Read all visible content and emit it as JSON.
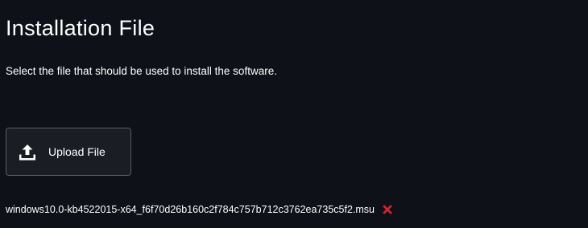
{
  "page": {
    "title": "Installation File",
    "description": "Select the file that should be used to install the software."
  },
  "upload": {
    "label": "Upload File",
    "icon": "upload-icon"
  },
  "file": {
    "name": "windows10.0-kb4522015-x64_f6f70d26b160c2f784c757b712c3762ea735c5f2.msu",
    "remove_icon": "close-icon",
    "remove_color": "#d7262b"
  },
  "colors": {
    "background": "#0f1118",
    "button_background": "#1b1d24",
    "button_border": "#5a5c63",
    "text": "#ffffff"
  }
}
